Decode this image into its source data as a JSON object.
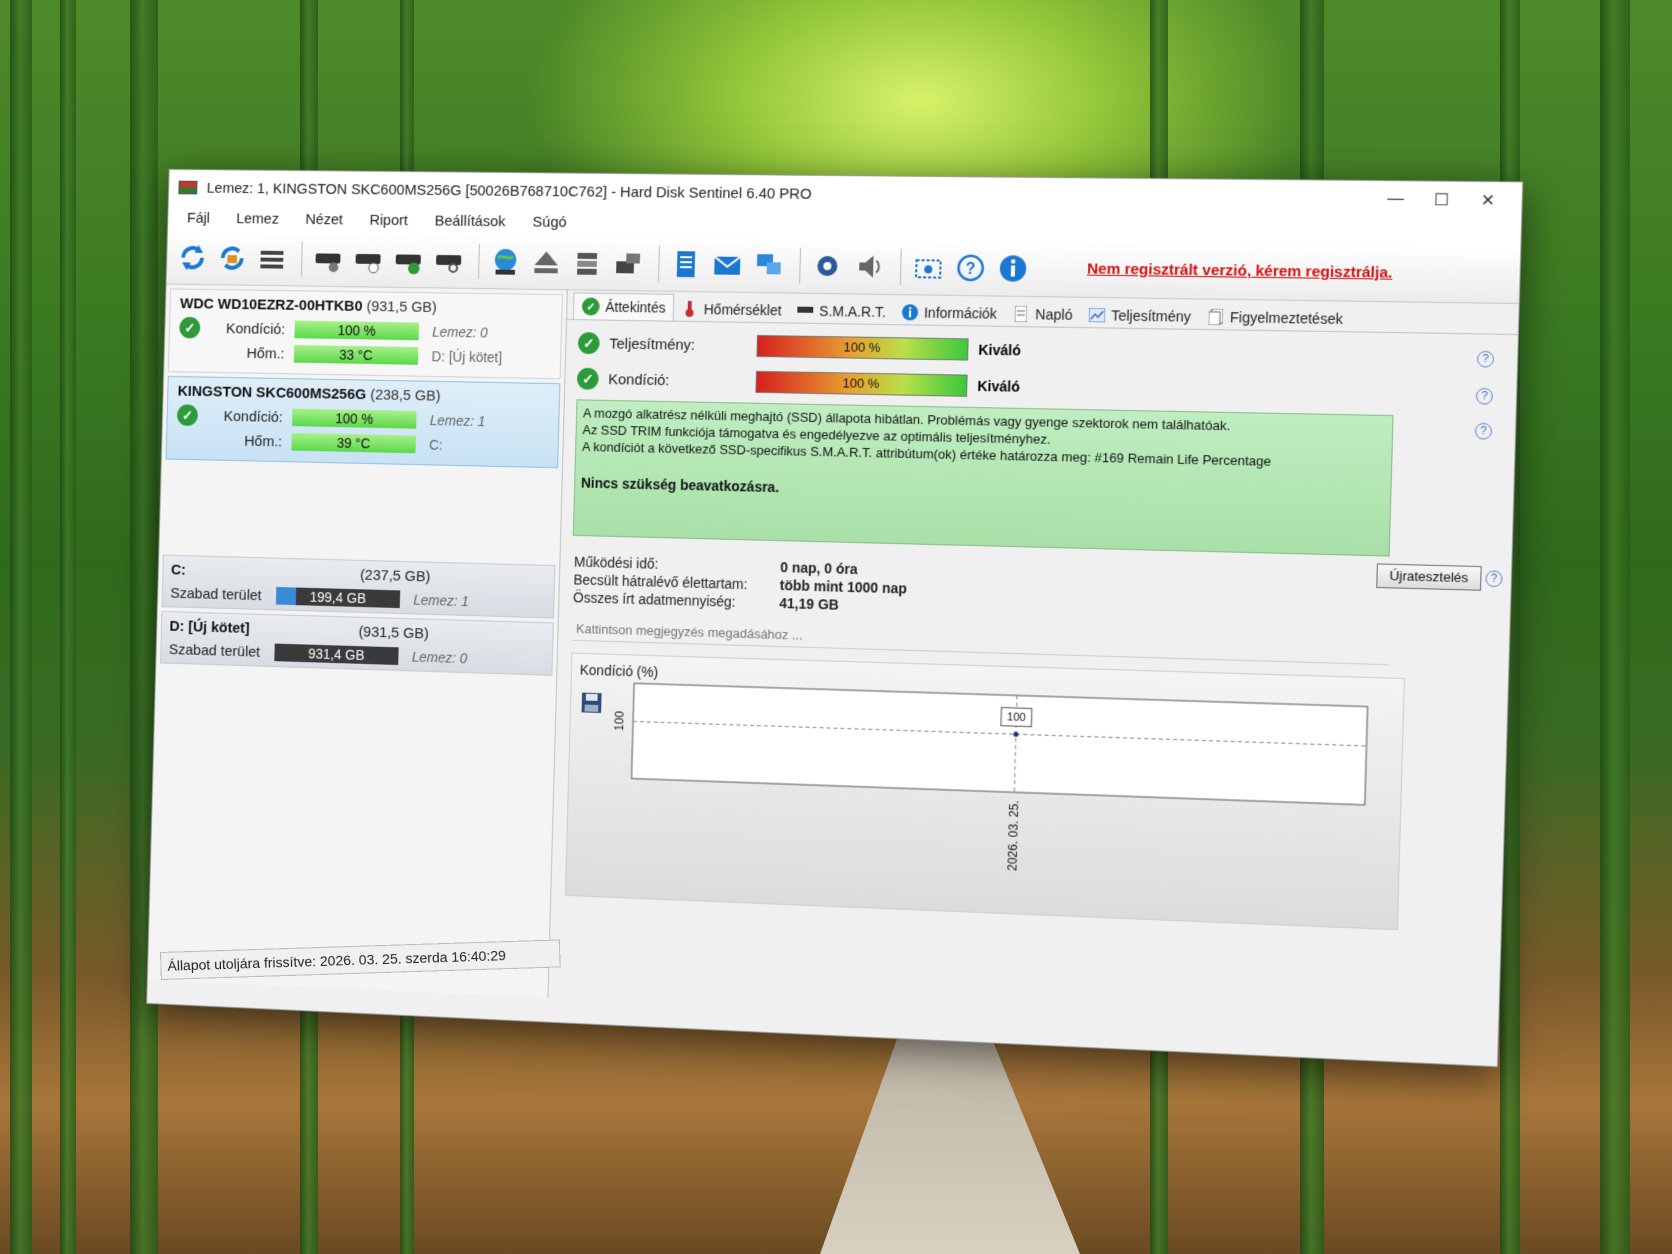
{
  "window": {
    "title": "Lemez: 1, KINGSTON SKC600MS256G [50026B768710C762]  -  Hard Disk Sentinel 6.40 PRO",
    "minimize": "—",
    "maximize": "☐",
    "close": "✕"
  },
  "menu": [
    "Fájl",
    "Lemez",
    "Nézet",
    "Riport",
    "Beállítások",
    "Súgó"
  ],
  "registration_notice": "Nem regisztrált verzió, kérem regisztrálja.",
  "disks": [
    {
      "name": "WDC WD10EZRZ-00HTKB0",
      "size": "(931,5 GB)",
      "condition_label": "Kondíció:",
      "condition": "100 %",
      "condition_extra": "Lemez: 0",
      "temp_label": "Hőm.:",
      "temp": "33 °C",
      "temp_extra": "D: [Új kötet]"
    },
    {
      "name": "KINGSTON SKC600MS256G",
      "size": "(238,5 GB)",
      "condition_label": "Kondíció:",
      "condition": "100 %",
      "condition_extra": "Lemez: 1",
      "temp_label": "Hőm.:",
      "temp": "39 °C",
      "temp_extra": "C:"
    }
  ],
  "volumes": [
    {
      "name": "C:",
      "size": "(237,5 GB)",
      "free_label": "Szabad terület",
      "free": "199,4 GB",
      "free_fraction": 0.16,
      "disk": "Lemez: 1"
    },
    {
      "name": "D: [Új kötet]",
      "size": "(931,5 GB)",
      "free_label": "Szabad terület",
      "free": "931,4 GB",
      "free_fraction": 0.0,
      "disk": "Lemez: 0"
    }
  ],
  "tabs": [
    "Áttekintés",
    "Hőmérséklet",
    "S.M.A.R.T.",
    "Információk",
    "Napló",
    "Teljesítmény",
    "Figyelmeztetések"
  ],
  "status": {
    "performance_label": "Teljesítmény:",
    "performance": "100 %",
    "performance_rating": "Kiváló",
    "condition_label": "Kondíció:",
    "condition": "100 %",
    "condition_rating": "Kiváló"
  },
  "info_lines": [
    "A mozgó alkatrész nélküli meghajtó (SSD) állapota hibátlan. Problémás vagy gyenge szektorok nem találhatóak.",
    "Az SSD TRIM funkciója támogatva és engedélyezve az optimális teljesítményhez.",
    "A kondíciót a következő SSD-specifikus S.M.A.R.T. attribútum(ok) értéke határozza meg:  #169 Remain Life Percentage"
  ],
  "info_action": "Nincs szükség beavatkozásra.",
  "details": {
    "uptime_label": "Működési idő:",
    "uptime": "0 nap, 0 óra",
    "life_label": "Becsült hátralévő élettartam:",
    "life": "több mint 1000 nap",
    "written_label": "Összes írt adatmennyiség:",
    "written": "41,19 GB"
  },
  "retest_button": "Újratesztelés",
  "note_placeholder": "Kattintson megjegyzés megadásához ...",
  "chart_data": {
    "type": "line",
    "title": "Kondíció  (%)",
    "x": [
      "2026. 03. 25."
    ],
    "series": [
      {
        "values": [
          100
        ]
      }
    ],
    "y_tick_labels": [
      "100"
    ],
    "data_labels": [
      "100"
    ],
    "ylim": [
      0,
      100
    ],
    "grid": true
  },
  "statusbar": "Állapot utoljára frissítve: 2026. 03. 25. szerda 16:40:29",
  "help": "?"
}
